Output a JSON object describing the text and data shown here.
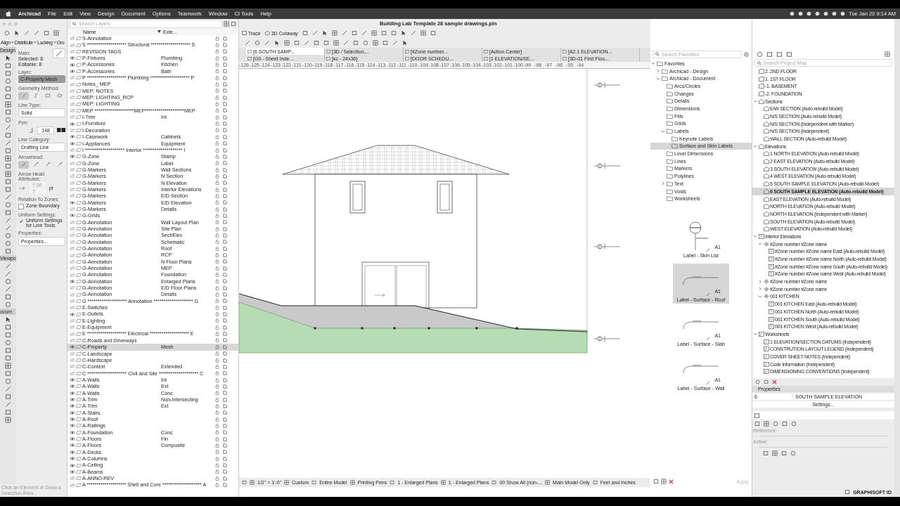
{
  "menu_bar": {
    "app": "Archicad",
    "items": [
      "File",
      "Edit",
      "View",
      "Design",
      "Document",
      "Options",
      "Teamwork",
      "Window",
      "CI Tools",
      "Help"
    ],
    "clock": "Tue Jan 20  9:14 AM"
  },
  "window": {
    "title": "Building Lab Template 28 sample drawings.pln"
  },
  "arrange_bar": [
    "Align",
    "Distribute",
    "Locking",
    "Gro"
  ],
  "toolbox": {
    "sections": [
      "Design",
      "Viewpo",
      "ocum"
    ]
  },
  "info_box": {
    "main_label": "Main:",
    "selected": "Selected: 8",
    "editable": "Editable: 8",
    "layer_label": "Layer:",
    "layer": "C-Property.Mesh",
    "geometry_label": "Geometry Method:",
    "line_type_label": "Line Type:",
    "line_type": "Solid",
    "pen_label": "Pen:",
    "pen": "148",
    "line_category_label": "Line Category:",
    "line_category": "Drafting Line",
    "arrowhead_label": "Arrowhead:",
    "arrow_attr_label": "Arrow Head Attributes:",
    "arrow_size": "7.00",
    "arrow_unit": "pt",
    "arrow_pen": "7",
    "zones_label": "Relation To Zones:",
    "zone_boundary": {
      "label": "Zone Boundary",
      "checked": false
    },
    "uniform_label": "Uniform Settings:",
    "uniform": {
      "label": "Uniform Settings for Line Tools",
      "checked": true
    },
    "properties_label": "Properties:",
    "properties_button": "Properties..."
  },
  "layers": {
    "search_placeholder": "Search Layers",
    "columns": [
      "Name",
      "Exte..."
    ],
    "rows": [
      {
        "name": "S-Annotation",
        "ext": "",
        "visible": false,
        "selected": false
      },
      {
        "name": "S ******************** Structural ******************** S",
        "ext": "",
        "visible": false,
        "selected": false
      },
      {
        "name": "REVISION TAGS",
        "ext": "",
        "visible": false,
        "selected": false
      },
      {
        "name": "P-Fixtures",
        "ext": "Plumbing",
        "visible": true,
        "selected": false
      },
      {
        "name": "P-Accessories",
        "ext": "Kitchen",
        "visible": true,
        "selected": false
      },
      {
        "name": "P-Accessories",
        "ext": "Bath",
        "visible": true,
        "selected": false
      },
      {
        "name": "P ******************** Plumbing ******************** P",
        "ext": "",
        "visible": false,
        "selected": false
      },
      {
        "name": "Notes_ MEP",
        "ext": "",
        "visible": false,
        "selected": false
      },
      {
        "name": "MEP: NOTES",
        "ext": "",
        "visible": false,
        "selected": false
      },
      {
        "name": "MEP: LIGHTING_RCP",
        "ext": "",
        "visible": false,
        "selected": false
      },
      {
        "name": "MEP: LIGHTING",
        "ext": "",
        "visible": false,
        "selected": false
      },
      {
        "name": "MEP ********************MEP********************MEP",
        "ext": "",
        "visible": false,
        "selected": false
      },
      {
        "name": "I-Trim",
        "ext": "Int",
        "visible": false,
        "selected": false
      },
      {
        "name": "I-Furniture",
        "ext": "",
        "visible": true,
        "selected": false
      },
      {
        "name": "I-Decoration",
        "ext": "",
        "visible": false,
        "selected": false
      },
      {
        "name": "I-Casework",
        "ext": "Cabinets",
        "visible": true,
        "selected": false
      },
      {
        "name": "I-Appliances",
        "ext": "Equipment",
        "visible": true,
        "selected": false
      },
      {
        "name": "I ******************** Interior ******************** I",
        "ext": "",
        "visible": false,
        "selected": false
      },
      {
        "name": "G-Zone",
        "ext": "Stamp",
        "visible": true,
        "selected": false
      },
      {
        "name": "G-Zone",
        "ext": "Label",
        "visible": false,
        "selected": false
      },
      {
        "name": "G-Markers",
        "ext": "Wall Sections",
        "visible": false,
        "selected": false
      },
      {
        "name": "G-Markers",
        "ext": "N Section",
        "visible": false,
        "selected": false
      },
      {
        "name": "G-Markers",
        "ext": "N Elevation",
        "visible": false,
        "selected": false
      },
      {
        "name": "G-Markers",
        "ext": "Interior Elevations",
        "visible": false,
        "selected": false
      },
      {
        "name": "G-Markers",
        "ext": "E/D Section",
        "visible": false,
        "selected": false
      },
      {
        "name": "G-Markers",
        "ext": "E/D Elevation",
        "visible": true,
        "selected": false
      },
      {
        "name": "G-Markers",
        "ext": "Details",
        "visible": false,
        "selected": false
      },
      {
        "name": "G-Grids",
        "ext": "",
        "visible": true,
        "selected": false
      },
      {
        "name": "G-Annotation",
        "ext": "Wall Layout Plan",
        "visible": false,
        "selected": false
      },
      {
        "name": "G-Annotation",
        "ext": "Site Plan",
        "visible": false,
        "selected": false
      },
      {
        "name": "G-Annotation",
        "ext": "Sect/Elev",
        "visible": false,
        "selected": false
      },
      {
        "name": "G-Annotation",
        "ext": "Schematic",
        "visible": false,
        "selected": false
      },
      {
        "name": "G-Annotation",
        "ext": "Roof",
        "visible": false,
        "selected": false
      },
      {
        "name": "G-Annotation",
        "ext": "RCP",
        "visible": false,
        "selected": false
      },
      {
        "name": "G-Annotation",
        "ext": "N Floor Plans",
        "visible": false,
        "selected": false
      },
      {
        "name": "G-Annotation",
        "ext": "MEP",
        "visible": false,
        "selected": false
      },
      {
        "name": "G-Annotation",
        "ext": "Foundation",
        "visible": false,
        "selected": false
      },
      {
        "name": "G-Annotation",
        "ext": "Enlarged Plans",
        "visible": true,
        "selected": false
      },
      {
        "name": "G-Annotation",
        "ext": "E/D Floor Plans",
        "visible": false,
        "selected": false
      },
      {
        "name": "G-Annotation",
        "ext": "Details",
        "visible": false,
        "selected": false
      },
      {
        "name": "G ******************** Annotation ******************** G",
        "ext": "",
        "visible": false,
        "selected": false
      },
      {
        "name": "E-Switches",
        "ext": "",
        "visible": false,
        "selected": false
      },
      {
        "name": "E-Outlets",
        "ext": "",
        "visible": true,
        "selected": false
      },
      {
        "name": "E-Lighting",
        "ext": "",
        "visible": false,
        "selected": false
      },
      {
        "name": "E-Equipment",
        "ext": "",
        "visible": false,
        "selected": false
      },
      {
        "name": "E ******************** Electrical ******************** E",
        "ext": "",
        "visible": false,
        "selected": false
      },
      {
        "name": "C-Roads and Driveways",
        "ext": "",
        "visible": false,
        "selected": false
      },
      {
        "name": "C-Property",
        "ext": "Mesh",
        "visible": true,
        "selected": true
      },
      {
        "name": "C-Landscape",
        "ext": "",
        "visible": false,
        "selected": false
      },
      {
        "name": "C-Hardscape",
        "ext": "",
        "visible": false,
        "selected": false
      },
      {
        "name": "C-Context",
        "ext": "Extended",
        "visible": false,
        "selected": false
      },
      {
        "name": "C ******************** Civil and Site ******************** C",
        "ext": "",
        "visible": false,
        "selected": false
      },
      {
        "name": "A-Walls",
        "ext": "Int",
        "visible": true,
        "selected": false
      },
      {
        "name": "A-Walls",
        "ext": "Ext",
        "visible": true,
        "selected": false
      },
      {
        "name": "A-Walls",
        "ext": "Conc",
        "visible": true,
        "selected": false
      },
      {
        "name": "A-Trim",
        "ext": "Non-Intersecting",
        "visible": true,
        "selected": false
      },
      {
        "name": "A-Trim",
        "ext": "Ext",
        "visible": true,
        "selected": false
      },
      {
        "name": "A-Stairs",
        "ext": "",
        "visible": true,
        "selected": false
      },
      {
        "name": "A-Roof",
        "ext": "",
        "visible": true,
        "selected": false
      },
      {
        "name": "A-Railings",
        "ext": "",
        "visible": true,
        "selected": false
      },
      {
        "name": "A-Foundation",
        "ext": "Conc",
        "visible": true,
        "selected": false
      },
      {
        "name": "A-Floors",
        "ext": "Fin",
        "visible": true,
        "selected": false
      },
      {
        "name": "A-Floors",
        "ext": "Composite",
        "visible": true,
        "selected": false
      },
      {
        "name": "A-Decks",
        "ext": "",
        "visible": true,
        "selected": false
      },
      {
        "name": "A-Columns",
        "ext": "",
        "visible": true,
        "selected": false
      },
      {
        "name": "A-Ceiling",
        "ext": "",
        "visible": true,
        "selected": false
      },
      {
        "name": "A-Beams",
        "ext": "",
        "visible": true,
        "selected": false
      },
      {
        "name": "A-ANNO-REV",
        "ext": "",
        "visible": false,
        "selected": false
      },
      {
        "name": "A ******************** Shell and Core ******************** A",
        "ext": "",
        "visible": false,
        "selected": false
      }
    ]
  },
  "toolbar": {
    "trace": "Trace",
    "cutaway": "3D Cutaway"
  },
  "tabs": [
    {
      "label": "[6 SOUTH SAMP...",
      "selected": true
    },
    {
      "label": "[3D / Selection,...",
      "selected": false
    },
    {
      "label": "[#Zone number...",
      "selected": false
    },
    {
      "label": "[Action Center]",
      "selected": false
    },
    {
      "label": "[A2.1 ELEVATION...",
      "selected": false
    },
    {
      "label": "[G0 - Sheet Inde...",
      "selected": false
    },
    {
      "label": "[kc - 24x36]",
      "selected": false
    },
    {
      "label": "[DOOR SCHEDU...",
      "selected": false
    },
    {
      "label": "[1 ELEVATION/SE...",
      "selected": false
    },
    {
      "label": "[3D-01 First Floo...",
      "selected": false
    }
  ],
  "ruler": {
    "labels": [
      "-126",
      "-125",
      "-124",
      "-123",
      "-122",
      "-121",
      "-120",
      "-119",
      "-118",
      "-117",
      "-116",
      "-115",
      "-114",
      "-113",
      "-112",
      "-111",
      "-110",
      "-109",
      "-108",
      "-107",
      "-106",
      "-105",
      "-104",
      "-103",
      "-102",
      "-101",
      "-100",
      "-99",
      "-98",
      "-97",
      "-96",
      "-95",
      "-94"
    ]
  },
  "status_bar": {
    "items": [
      "1/2\" = 1'-0\"",
      "Custom",
      "Entire Model",
      "Printing Pens",
      "1 - Enlarged Plans",
      "1 - Enlarged Plans",
      "00 Show All (non-...",
      "Main Model Only",
      "Feet and Inches"
    ],
    "hint": "Click an Element or Draw a Selection Area..."
  },
  "favorites": {
    "search_placeholder": "Search Favorites",
    "items": [
      {
        "label": "Favorites",
        "kind": "root",
        "selected": false,
        "expanded": true,
        "children": [
          {
            "label": "Archicad - Design",
            "kind": "folder",
            "selected": false,
            "expanded": false
          },
          {
            "label": "Archicad - Document",
            "kind": "folder",
            "selected": false,
            "expanded": true,
            "children": [
              {
                "label": "Arcs/Circles",
                "kind": "folder",
                "selected": false
              },
              {
                "label": "Changes",
                "kind": "folder",
                "selected": false
              },
              {
                "label": "Details",
                "kind": "folder",
                "selected": false
              },
              {
                "label": "Dimensions",
                "kind": "folder",
                "selected": false
              },
              {
                "label": "Fills",
                "kind": "folder",
                "selected": false
              },
              {
                "label": "Grids",
                "kind": "folder",
                "selected": false
              },
              {
                "label": "Labels",
                "kind": "folder",
                "selected": false,
                "expanded": true,
                "children": [
                  {
                    "label": "Keynote Labels",
                    "kind": "folder",
                    "selected": false
                  },
                  {
                    "label": "Surface and Skin Labels",
                    "kind": "folder",
                    "selected": true
                  }
                ]
              },
              {
                "label": "Level Dimensions",
                "kind": "folder",
                "selected": false
              },
              {
                "label": "Lines",
                "kind": "folder",
                "selected": false
              },
              {
                "label": "Markers",
                "kind": "folder",
                "selected": false
              },
              {
                "label": "Polylines",
                "kind": "folder",
                "selected": false
              },
              {
                "label": "Text",
                "kind": "folder",
                "selected": false,
                "expanded": false
              },
              {
                "label": "Voids",
                "kind": "folder",
                "selected": false
              },
              {
                "label": "Worksheets",
                "kind": "folder",
                "selected": false
              }
            ]
          }
        ]
      }
    ],
    "previews": [
      {
        "label": "Label - Skin List",
        "tag": "A1",
        "kind": "skin",
        "selected": false
      },
      {
        "label": "Label - Surface - Roof",
        "tag": "A1",
        "kind": "surface",
        "selected": true
      },
      {
        "label": "Label - Surface - Slab",
        "tag": "A1",
        "kind": "surface",
        "selected": false
      },
      {
        "label": "Label - Surface - Wall",
        "tag": "A1",
        "kind": "surface",
        "selected": false
      }
    ],
    "apply": "Apply"
  },
  "project_map": {
    "search_placeholder": "Search Project Map",
    "items": [
      {
        "label": "2. 2ND FLOOR",
        "kind": "story",
        "selected": false
      },
      {
        "label": "1. 1ST FLOOR",
        "kind": "story",
        "selected": false
      },
      {
        "label": "-1. BASEMENT",
        "kind": "story",
        "selected": false
      },
      {
        "label": "-2. FOUNDATION",
        "kind": "story",
        "selected": false
      },
      {
        "label": "Sections",
        "kind": "group",
        "selected": false,
        "expanded": true,
        "children": [
          {
            "label": "E/W SECTION (Auto-rebuild Model)",
            "kind": "view",
            "selected": false
          },
          {
            "label": "N/S SECTION (Auto-rebuild Model)",
            "kind": "view",
            "selected": false
          },
          {
            "label": "N/S SECTION (Independent with Marker)",
            "kind": "view",
            "selected": false
          },
          {
            "label": "N/S SECTION (Independent)",
            "kind": "view",
            "selected": false
          },
          {
            "label": "WALL SECTION (Auto-rebuild Model)",
            "kind": "view",
            "selected": false
          }
        ]
      },
      {
        "label": "Elevations",
        "kind": "group",
        "selected": false,
        "expanded": true,
        "children": [
          {
            "label": "1 NORTH ELEVATION (Auto-rebuild Model)",
            "kind": "view",
            "selected": false
          },
          {
            "label": "2 EAST ELEVATION (Auto-rebuild Model)",
            "kind": "view",
            "selected": false
          },
          {
            "label": "3 SOUTH ELEVATION (Auto-rebuild Model)",
            "kind": "view",
            "selected": false
          },
          {
            "label": "4 WEST ELEVATION (Auto-rebuild Model)",
            "kind": "view",
            "selected": false
          },
          {
            "label": "5 SOUTH SAMPLE ELEVATION (Auto-rebuild Model)",
            "kind": "view",
            "selected": false
          },
          {
            "label": "6 SOUTH SAMPLE ELEVATION (Auto-rebuild Model)",
            "kind": "view",
            "selected": true
          },
          {
            "label": "EAST ELEVATION (Auto-rebuild Model)",
            "kind": "view",
            "selected": false
          },
          {
            "label": "NORTH ELEVATION (Auto-rebuild Model)",
            "kind": "view",
            "selected": false
          },
          {
            "label": "NORTH ELEVATION (Independent with Marker)",
            "kind": "view",
            "selected": false
          },
          {
            "label": "SOUTH ELEVATION (Auto-rebuild Model)",
            "kind": "view",
            "selected": false
          },
          {
            "label": "WEST ELEVATION (Auto-rebuild Model)",
            "kind": "view",
            "selected": false
          }
        ]
      },
      {
        "label": "Interior Elevations",
        "kind": "interior",
        "selected": false,
        "expanded": true,
        "children": [
          {
            "label": "#Zone number #Zone name",
            "kind": "zone",
            "selected": false,
            "expanded": true,
            "children": [
              {
                "label": "#Zone number #Zone name East (Auto-rebuild Model)",
                "kind": "interior",
                "selected": false
              },
              {
                "label": "#Zone number #Zone name North (Auto-rebuild Model)",
                "kind": "interior",
                "selected": false
              },
              {
                "label": "#Zone number #Zone name South (Auto-rebuild Model)",
                "kind": "interior",
                "selected": false
              },
              {
                "label": "#Zone number #Zone name West (Auto-rebuild Model)",
                "kind": "interior",
                "selected": false
              }
            ]
          },
          {
            "label": "#Zone number #Zone name",
            "kind": "zone",
            "selected": false,
            "expanded": false
          },
          {
            "label": "#Zone number #Zone name",
            "kind": "zone",
            "selected": false,
            "expanded": false
          },
          {
            "label": "001 KITCHEN",
            "kind": "zone",
            "selected": false,
            "expanded": true,
            "children": [
              {
                "label": "001 KITCHEN East (Auto-rebuild Model)",
                "kind": "interior",
                "selected": false
              },
              {
                "label": "001 KITCHEN North (Auto-rebuild Model)",
                "kind": "interior",
                "selected": false
              },
              {
                "label": "001 KITCHEN South (Auto-rebuild Model)",
                "kind": "interior",
                "selected": false
              },
              {
                "label": "001 KITCHEN West (Auto-rebuild Model)",
                "kind": "interior",
                "selected": false
              }
            ]
          }
        ]
      },
      {
        "label": "Worksheets",
        "kind": "worksheet",
        "selected": false,
        "expanded": true,
        "children": [
          {
            "label": "1 ELEVATION/SECTION DATUMS (Independent)",
            "kind": "worksheet",
            "selected": false
          },
          {
            "label": "CONSTRUTION LAYOUT LEGEND (Independent)",
            "kind": "worksheet",
            "selected": false
          },
          {
            "label": "COVER SHEET NOTES (Independent)",
            "kind": "worksheet",
            "selected": false
          },
          {
            "label": "Code Information (Independent)",
            "kind": "worksheet",
            "selected": false
          },
          {
            "label": "DIMENSIONING CONVENTIONS (Independent)",
            "kind": "worksheet",
            "selected": false
          }
        ]
      }
    ]
  },
  "properties": {
    "header": "Properties",
    "id": "6",
    "name": "SOUTH SAMPLE ELEVATION",
    "settings": "Settings...",
    "reference_label": "Reference:",
    "active_label": "Active:"
  },
  "graphisoft": "GRAPHISOFT ID"
}
